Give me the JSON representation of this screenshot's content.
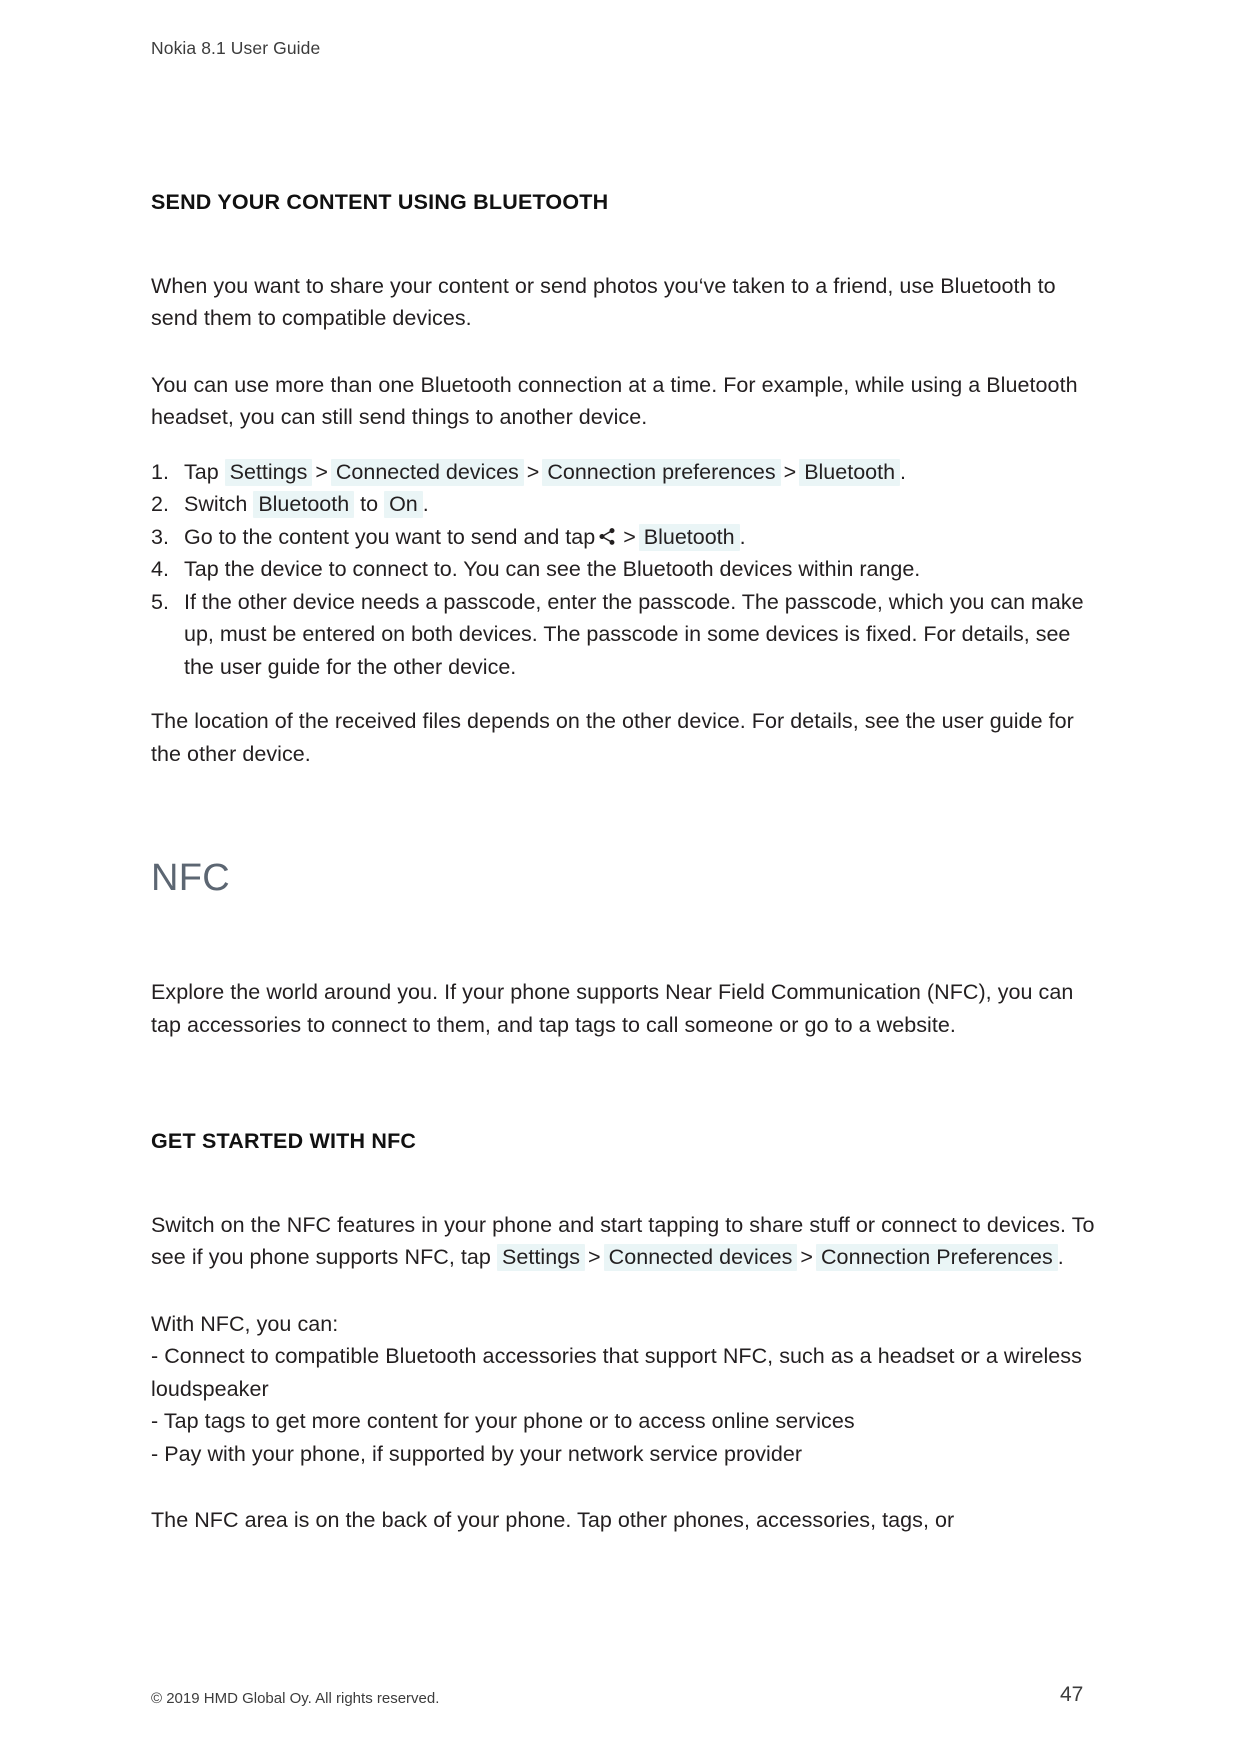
{
  "document": {
    "running_head": "Nokia 8.1 User Guide",
    "footer_copyright": "© 2019 HMD Global Oy. All rights reserved.",
    "page_number": "47",
    "highlight_color": "#eaf5f6",
    "heading_color": "#5c6672",
    "body_color": "#231f20"
  },
  "bluetooth_section": {
    "heading": "SEND YOUR CONTENT USING BLUETOOTH",
    "intro_paragraph": "When you want to share your content or send photos you‘ve taken to a friend, use Bluetooth to send them to compatible devices.",
    "second_paragraph": "You can use more than one Bluetooth connection at a time. For example, while using a Bluetooth headset, you can still send things to another device.",
    "steps": [
      {
        "number": "1.",
        "lead": "Tap",
        "ui_terms": [
          "Settings",
          "Connected devices",
          "Connection preferences",
          "Bluetooth"
        ],
        "separator": ">",
        "trailing": "."
      },
      {
        "number": "2.",
        "lead": "Switch",
        "ui_term_1": "Bluetooth",
        "middle": "to",
        "ui_term_2": "On",
        "trailing": "."
      },
      {
        "number": "3.",
        "lead": "Go to the content you want to send and tap",
        "icon": "share-icon",
        "separator": ">",
        "ui_term": "Bluetooth",
        "trailing": "."
      },
      {
        "number": "4.",
        "text": "Tap the device to connect to. You can see the Bluetooth devices within range."
      },
      {
        "number": "5.",
        "text": "If the other device needs a passcode, enter the passcode. The passcode, which you can make up, must be entered on both devices. The passcode in some devices is fixed. For details, see the user guide for the other device."
      }
    ],
    "closing_paragraph": "The location of the received files depends on the other device. For details, see the user guide for the other device."
  },
  "nfc_section": {
    "heading": "NFC",
    "intro_paragraph": "Explore the world around you. If your phone supports Near Field Communication (NFC), you can tap accessories to connect to them, and tap tags to call someone or go to a website.",
    "subheading": "GET STARTED WITH NFC",
    "switch_paragraph": {
      "part_1": "Switch on the NFC features in your phone and start tapping to share stuff or connect to devices. To see if you phone supports NFC, tap",
      "ui_term_1": "Settings",
      "separator_1": ">",
      "ui_term_2": "Connected devices",
      "separator_2": ">",
      "ui_term_3": "Connection Preferences",
      "trailing": "."
    },
    "capabilities_intro": "With NFC, you can:",
    "capabilities": [
      "- Connect to compatible Bluetooth accessories that support NFC, such as a headset or a wireless loudspeaker",
      "- Tap tags to get more content for your phone or to access online services",
      "- Pay with your phone, if supported by your network service provider"
    ],
    "closing_paragraph": "The NFC area is on the back of your phone. Tap other phones, accessories, tags, or"
  }
}
